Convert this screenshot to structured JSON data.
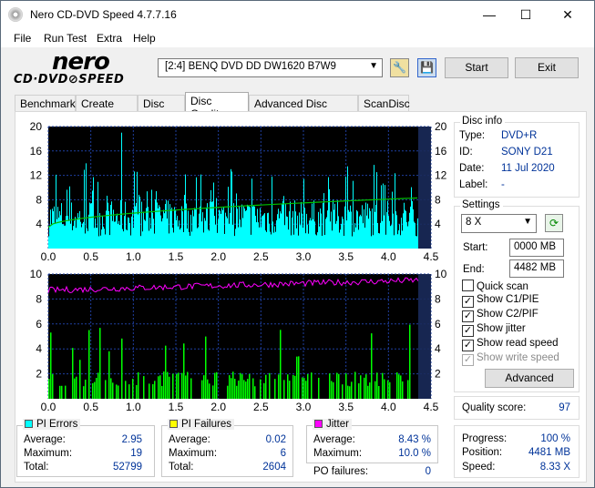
{
  "window": {
    "title": "Nero CD-DVD Speed 4.7.7.16",
    "minimize": "—",
    "maximize": "☐",
    "close": "✕"
  },
  "menu": [
    "File",
    "Run Test",
    "Extra",
    "Help"
  ],
  "toolbar": {
    "logo_top": "nero",
    "logo_bottom": "CD·DVD⊘SPEED",
    "drive": "[2:4]  BENQ DVD DD DW1620 B7W9",
    "start_label": "Start",
    "exit_label": "Exit"
  },
  "tabs": [
    "Benchmark",
    "Create Disc",
    "Disc Info",
    "Disc Quality",
    "Advanced Disc Quality",
    "ScanDisc"
  ],
  "active_tab": "Disc Quality",
  "disc_info": {
    "title": "Disc info",
    "type_label": "Type:",
    "type": "DVD+R",
    "id_label": "ID:",
    "id": "SONY D21",
    "date_label": "Date:",
    "date": "11 Jul 2020",
    "label_label": "Label:",
    "label": "-"
  },
  "settings": {
    "title": "Settings",
    "speed": "8 X",
    "start_label": "Start:",
    "start": "0000 MB",
    "end_label": "End:",
    "end": "4482 MB",
    "quick_scan": "Quick scan",
    "show_c1": "Show C1/PIE",
    "show_c2": "Show C2/PIF",
    "show_jitter": "Show jitter",
    "show_read": "Show read speed",
    "show_write": "Show write speed",
    "advanced": "Advanced",
    "checks": {
      "quick_scan": false,
      "show_c1": true,
      "show_c2": true,
      "show_jitter": true,
      "show_read": true,
      "show_write": true
    }
  },
  "quality": {
    "label": "Quality score:",
    "value": "97"
  },
  "progress": {
    "progress_label": "Progress:",
    "progress": "100 %",
    "position_label": "Position:",
    "position": "4481 MB",
    "speed_label": "Speed:",
    "speed": "8.33 X"
  },
  "pi_errors": {
    "title": "PI Errors",
    "color": "#00ffff",
    "avg_label": "Average:",
    "avg": "2.95",
    "max_label": "Maximum:",
    "max": "19",
    "total_label": "Total:",
    "total": "52799"
  },
  "pi_failures": {
    "title": "PI Failures",
    "color": "#ffff00",
    "avg_label": "Average:",
    "avg": "0.02",
    "max_label": "Maximum:",
    "max": "6",
    "total_label": "Total:",
    "total": "2604"
  },
  "jitter": {
    "title": "Jitter",
    "color": "#ff00ff",
    "avg_label": "Average:",
    "avg": "8.43 %",
    "max_label": "Maximum:",
    "max": "10.0 %",
    "po_label": "PO failures:",
    "po": "0"
  },
  "chart_data": [
    {
      "type": "area",
      "title": "PI Errors",
      "x_ticks": [
        "0.0",
        "0.5",
        "1.0",
        "1.5",
        "2.0",
        "2.5",
        "3.0",
        "3.5",
        "4.0",
        "4.5"
      ],
      "y_ticks_left": [
        "4",
        "8",
        "12",
        "16",
        "20"
      ],
      "y_ticks_right": [
        "4",
        "8",
        "12",
        "16",
        "20"
      ],
      "xlim": [
        0,
        4.5
      ],
      "ylim": [
        0,
        20
      ],
      "series": [
        {
          "name": "PI Errors",
          "color": "#00ffff",
          "typical_range": [
            2,
            8
          ],
          "max": 19
        },
        {
          "name": "Read speed",
          "color": "#00cc00",
          "start": 3.5,
          "end": 8.3
        }
      ],
      "grid": true
    },
    {
      "type": "bar",
      "title": "PI Failures / Jitter",
      "x_ticks": [
        "0.0",
        "0.5",
        "1.0",
        "1.5",
        "2.0",
        "2.5",
        "3.0",
        "3.5",
        "4.0",
        "4.5"
      ],
      "y_ticks_left": [
        "2",
        "4",
        "6",
        "8",
        "10"
      ],
      "y_ticks_right": [
        "2",
        "4",
        "6",
        "8",
        "10"
      ],
      "xlim": [
        0,
        4.5
      ],
      "ylim": [
        0,
        10
      ],
      "series": [
        {
          "name": "PI Failures",
          "color": "#00ff00",
          "max": 6
        },
        {
          "name": "Jitter",
          "color": "#ff00ff",
          "start": 8.7,
          "end": 9.5
        }
      ],
      "grid": true
    }
  ]
}
